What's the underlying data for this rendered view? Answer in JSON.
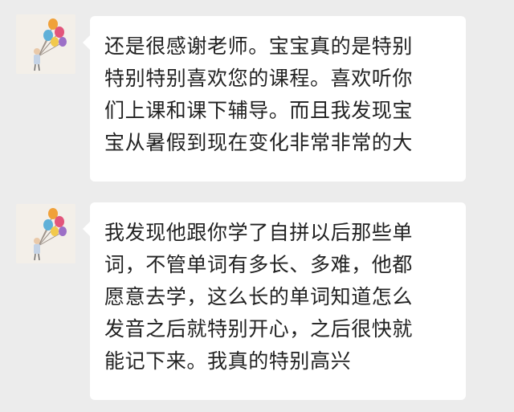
{
  "chat": {
    "messages": [
      {
        "sender_avatar": "balloon-avatar",
        "text": "还是很感谢老师。宝宝真的是特别\n特别特别喜欢您的课程。喜欢听你\n们上课和课下辅导。而且我发现宝\n宝从暑假到现在变化非常非常的大"
      },
      {
        "sender_avatar": "balloon-avatar",
        "text": "我发现他跟你学了自拼以后那些单\n词，不管单词有多长、多难，他都\n愿意去学，这么长的单词知道怎么\n发音之后就特别开心，之后很快就\n能记下来。我真的特别高兴"
      }
    ]
  },
  "colors": {
    "background": "#ececec",
    "bubble": "#ffffff",
    "text": "#222222"
  }
}
